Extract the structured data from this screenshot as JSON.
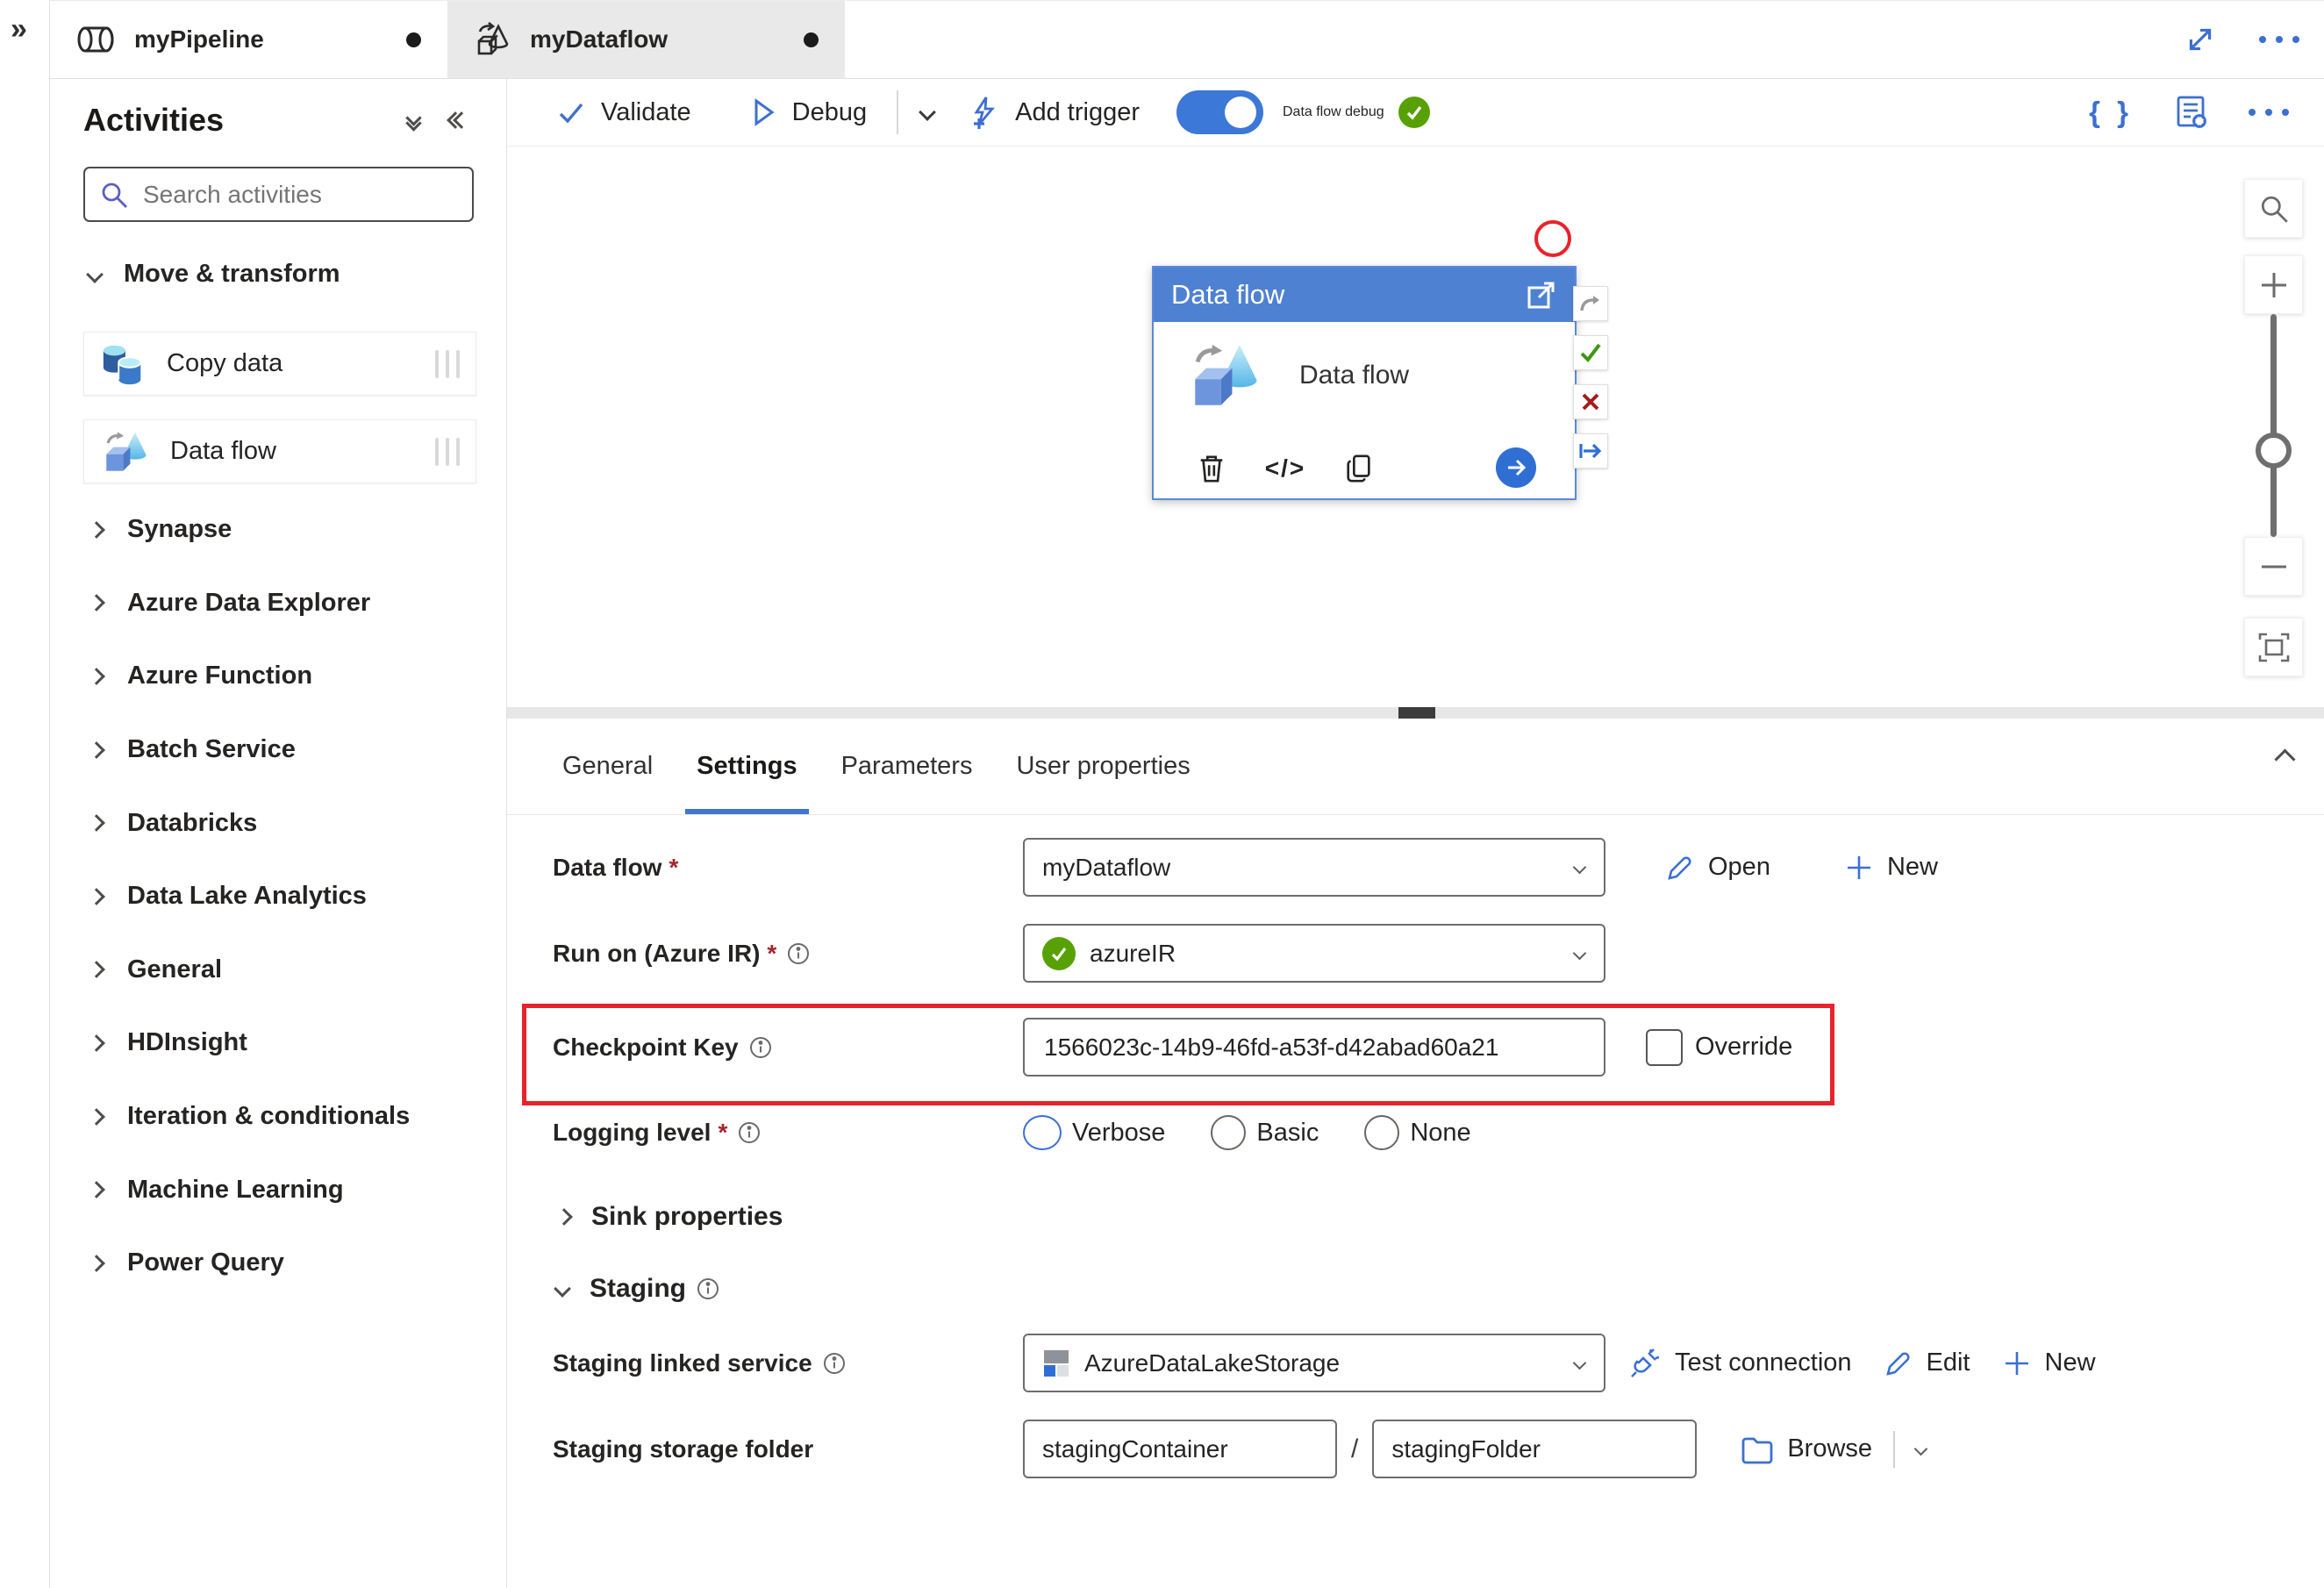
{
  "ui": {
    "required_mark": "*",
    "slash": "/"
  },
  "colors": {
    "accent_blue": "#3c6fd2",
    "node_header_blue": "#4e81d2",
    "toggle_on_blue": "#3b78d7",
    "success_green": "#57a105",
    "annotation_red": "#e8232a",
    "active_tab_bg": "#e9e9e9",
    "settings_underline_blue": "#4177cb"
  },
  "icons": [
    "double-chevron-right",
    "pipeline",
    "dataflow",
    "unsaved-dot",
    "resize-diagonal",
    "ellipsis",
    "validate-check",
    "debug-play",
    "chevron-down",
    "add-trigger-lightning",
    "toggle-on",
    "debug-ready-check",
    "code-braces",
    "pipeline-settings-list",
    "search",
    "double-chevron-down",
    "collapse-left",
    "drag-handle",
    "chevron-right",
    "open-in-new",
    "delete-trash",
    "view-code",
    "clone-copy",
    "go-arrow-circle",
    "rerun-arrow",
    "success-check",
    "error-x",
    "next-arrow",
    "zoom-in-plus",
    "zoom-out-minus",
    "zoom-slider",
    "fit-to-screen",
    "edit-pencil",
    "new-plus",
    "info",
    "test-connection-plug",
    "linked-service",
    "browse-folder",
    "override-checkbox",
    "logging-radio"
  ],
  "tabs": {
    "pipeline": "myPipeline",
    "dataflow": "myDataflow"
  },
  "toolbar": {
    "validate": "Validate",
    "debug": "Debug",
    "add_trigger": "Add trigger",
    "dataflow_debug": "Data flow debug"
  },
  "sidebar": {
    "title": "Activities",
    "search_placeholder": "Search activities",
    "section": "Move & transform",
    "activities": [
      "Copy data",
      "Data flow"
    ],
    "categories": [
      "Synapse",
      "Azure Data Explorer",
      "Azure Function",
      "Batch Service",
      "Databricks",
      "Data Lake Analytics",
      "General",
      "HDInsight",
      "Iteration & conditionals",
      "Machine Learning",
      "Power Query"
    ]
  },
  "canvas": {
    "node_title": "Data flow",
    "node_label": "Data flow"
  },
  "panel": {
    "tabs": [
      "General",
      "Settings",
      "Parameters",
      "User properties"
    ],
    "active_tab": "Settings",
    "data_flow": {
      "label": "Data flow",
      "value": "myDataflow",
      "open": "Open",
      "new": "New"
    },
    "run_on": {
      "label": "Run on (Azure IR)",
      "value": "azureIR"
    },
    "checkpoint": {
      "label": "Checkpoint Key",
      "value": "1566023c-14b9-46fd-a53f-d42abad60a21",
      "override": "Override"
    },
    "logging": {
      "label": "Logging level",
      "options": [
        "Verbose",
        "Basic",
        "None"
      ],
      "selected": "Verbose"
    },
    "sink": {
      "label": "Sink properties"
    },
    "staging": {
      "label": "Staging"
    },
    "staging_linked_service": {
      "label": "Staging linked service",
      "value": "AzureDataLakeStorage",
      "test": "Test connection",
      "edit": "Edit",
      "new": "New"
    },
    "staging_storage_folder": {
      "label": "Staging storage folder",
      "container": "stagingContainer",
      "folder": "stagingFolder",
      "browse": "Browse"
    }
  }
}
